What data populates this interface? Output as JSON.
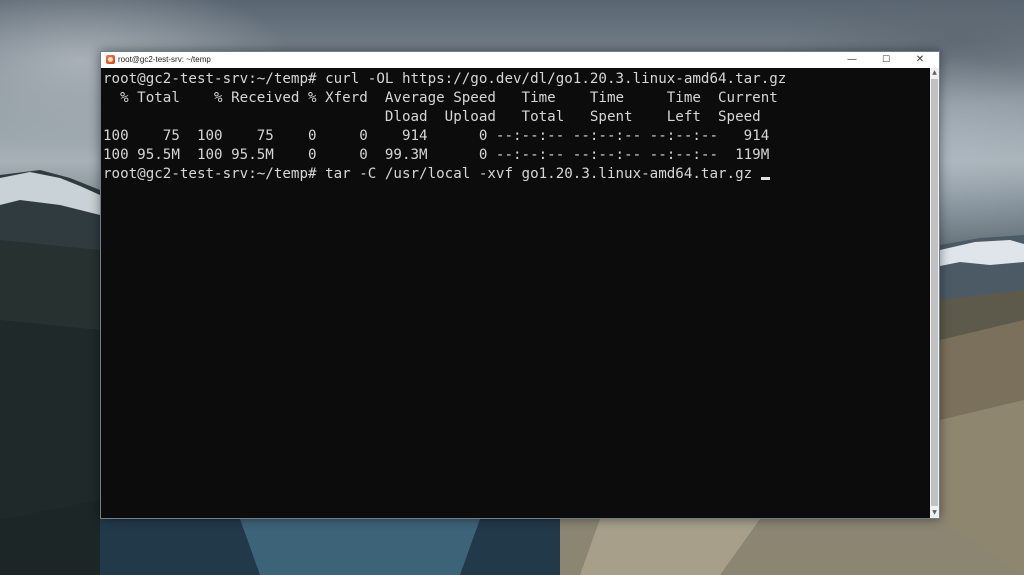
{
  "window": {
    "title": "root@gc2-test-srv: ~/temp",
    "icon": "terminal-app-icon",
    "controls": {
      "minimize": "—",
      "maximize": "☐",
      "close": "✕"
    }
  },
  "terminal": {
    "lines": [
      "root@gc2-test-srv:~/temp# curl -OL https://go.dev/dl/go1.20.3.linux-amd64.tar.gz",
      "  % Total    % Received % Xferd  Average Speed   Time    Time     Time  Current",
      "                                 Dload  Upload   Total   Spent    Left  Speed",
      "100    75  100    75    0     0    914      0 --:--:-- --:--:-- --:--:--   914",
      "100 95.5M  100 95.5M    0     0  99.3M      0 --:--:-- --:--:-- --:--:--  119M",
      "root@gc2-test-srv:~/temp# tar -C /usr/local -xvf go1.20.3.linux-amd64.tar.gz "
    ],
    "background": "#0c0c0c",
    "foreground": "#d6d6d6"
  },
  "scrollbar": {
    "up_arrow": "▲",
    "down_arrow": "▼"
  }
}
